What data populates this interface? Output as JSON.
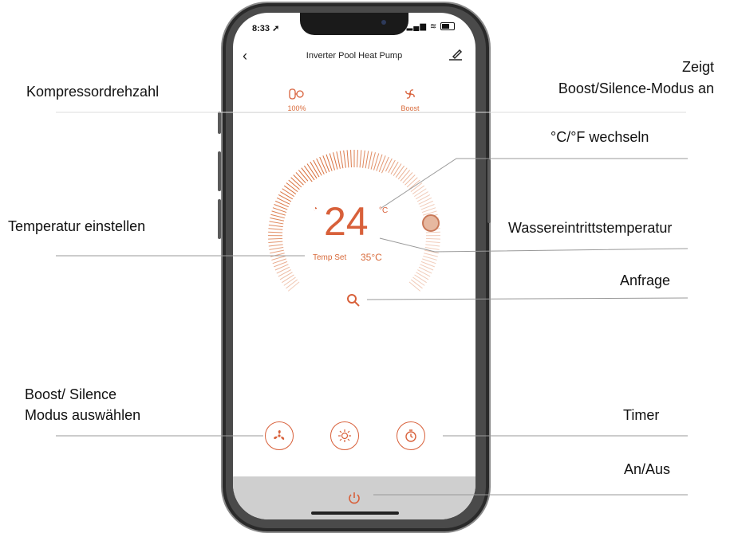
{
  "annotations": {
    "compressor_speed": "Kompressordrehzahl",
    "shows_mode_line1": "Zeigt",
    "shows_mode_line2": "Boost/Silence-Modus an",
    "switch_unit": "°C/°F  wechseln",
    "set_temperature": "Temperatur einstellen",
    "water_inlet_temp": "Wassereintrittstemperatur",
    "query": "Anfrage",
    "select_mode_line1": "Boost/ Silence",
    "select_mode_line2": "Modus auswählen",
    "timer": "Timer",
    "on_off": "An/Aus"
  },
  "status_bar": {
    "time": "8:33"
  },
  "app": {
    "title": "Inverter Pool Heat Pump",
    "compressor_value": "100%",
    "mode_value": "Boost",
    "current_temp": "24",
    "temp_unit": "°C",
    "set_label": "Temp Set",
    "set_value": "35°C"
  },
  "icons": {
    "back": "chevron-left-icon",
    "edit": "edit-icon",
    "compressor": "compressor-icon",
    "mode": "fan-icon",
    "search": "search-icon",
    "fan_mode": "fan-mode-icon",
    "heat": "sun-icon",
    "timer": "timer-icon",
    "power": "power-icon"
  },
  "colors": {
    "accent": "#d8603a",
    "bottom_bar": "#cfcfcf"
  }
}
